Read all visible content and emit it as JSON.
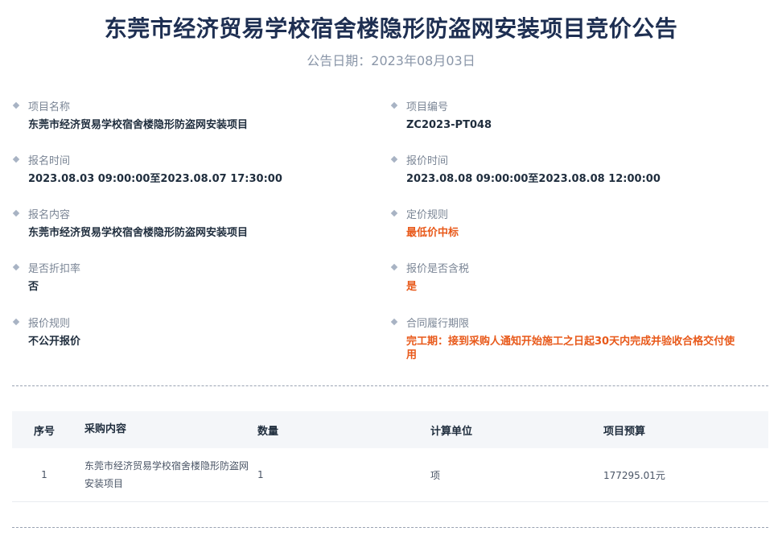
{
  "title": "东莞市经济贸易学校宿舍楼隐形防盗网安装项目竞价公告",
  "date_line": "公告日期：2023年08月03日",
  "fields": {
    "project_name": {
      "label": "项目名称",
      "value": "东莞市经济贸易学校宿舍楼隐形防盗网安装项目"
    },
    "project_no": {
      "label": "项目编号",
      "value": "ZC2023-PT048"
    },
    "signup_time": {
      "label": "报名时间",
      "value": "2023.08.03 09:00:00至2023.08.07 17:30:00"
    },
    "quote_time": {
      "label": "报价时间",
      "value": "2023.08.08 09:00:00至2023.08.08 12:00:00"
    },
    "signup_content": {
      "label": "报名内容",
      "value": "东莞市经济贸易学校宿舍楼隐形防盗网安装项目"
    },
    "pricing_rule": {
      "label": "定价规则",
      "value": "最低价中标"
    },
    "discount_rate": {
      "label": "是否折扣率",
      "value": "否"
    },
    "tax_included": {
      "label": "报价是否含税",
      "value": "是"
    },
    "quote_rule": {
      "label": "报价规则",
      "value": "不公开报价"
    },
    "contract_period": {
      "label": "合同履行期限",
      "value": "完工期：接到采购人通知开始施工之日起30天内完成并验收合格交付使用"
    }
  },
  "table": {
    "headers": [
      "序号",
      "采购内容",
      "数量",
      "计算单位",
      "项目预算"
    ],
    "rows": [
      [
        "1",
        "东莞市经济贸易学校宿舍楼隐形防盗网安装项目",
        "1",
        "项",
        "177295.01元"
      ]
    ]
  },
  "colors": {
    "title": "#1e2f52",
    "highlight": "#e8591a",
    "label": "#7a8595"
  }
}
